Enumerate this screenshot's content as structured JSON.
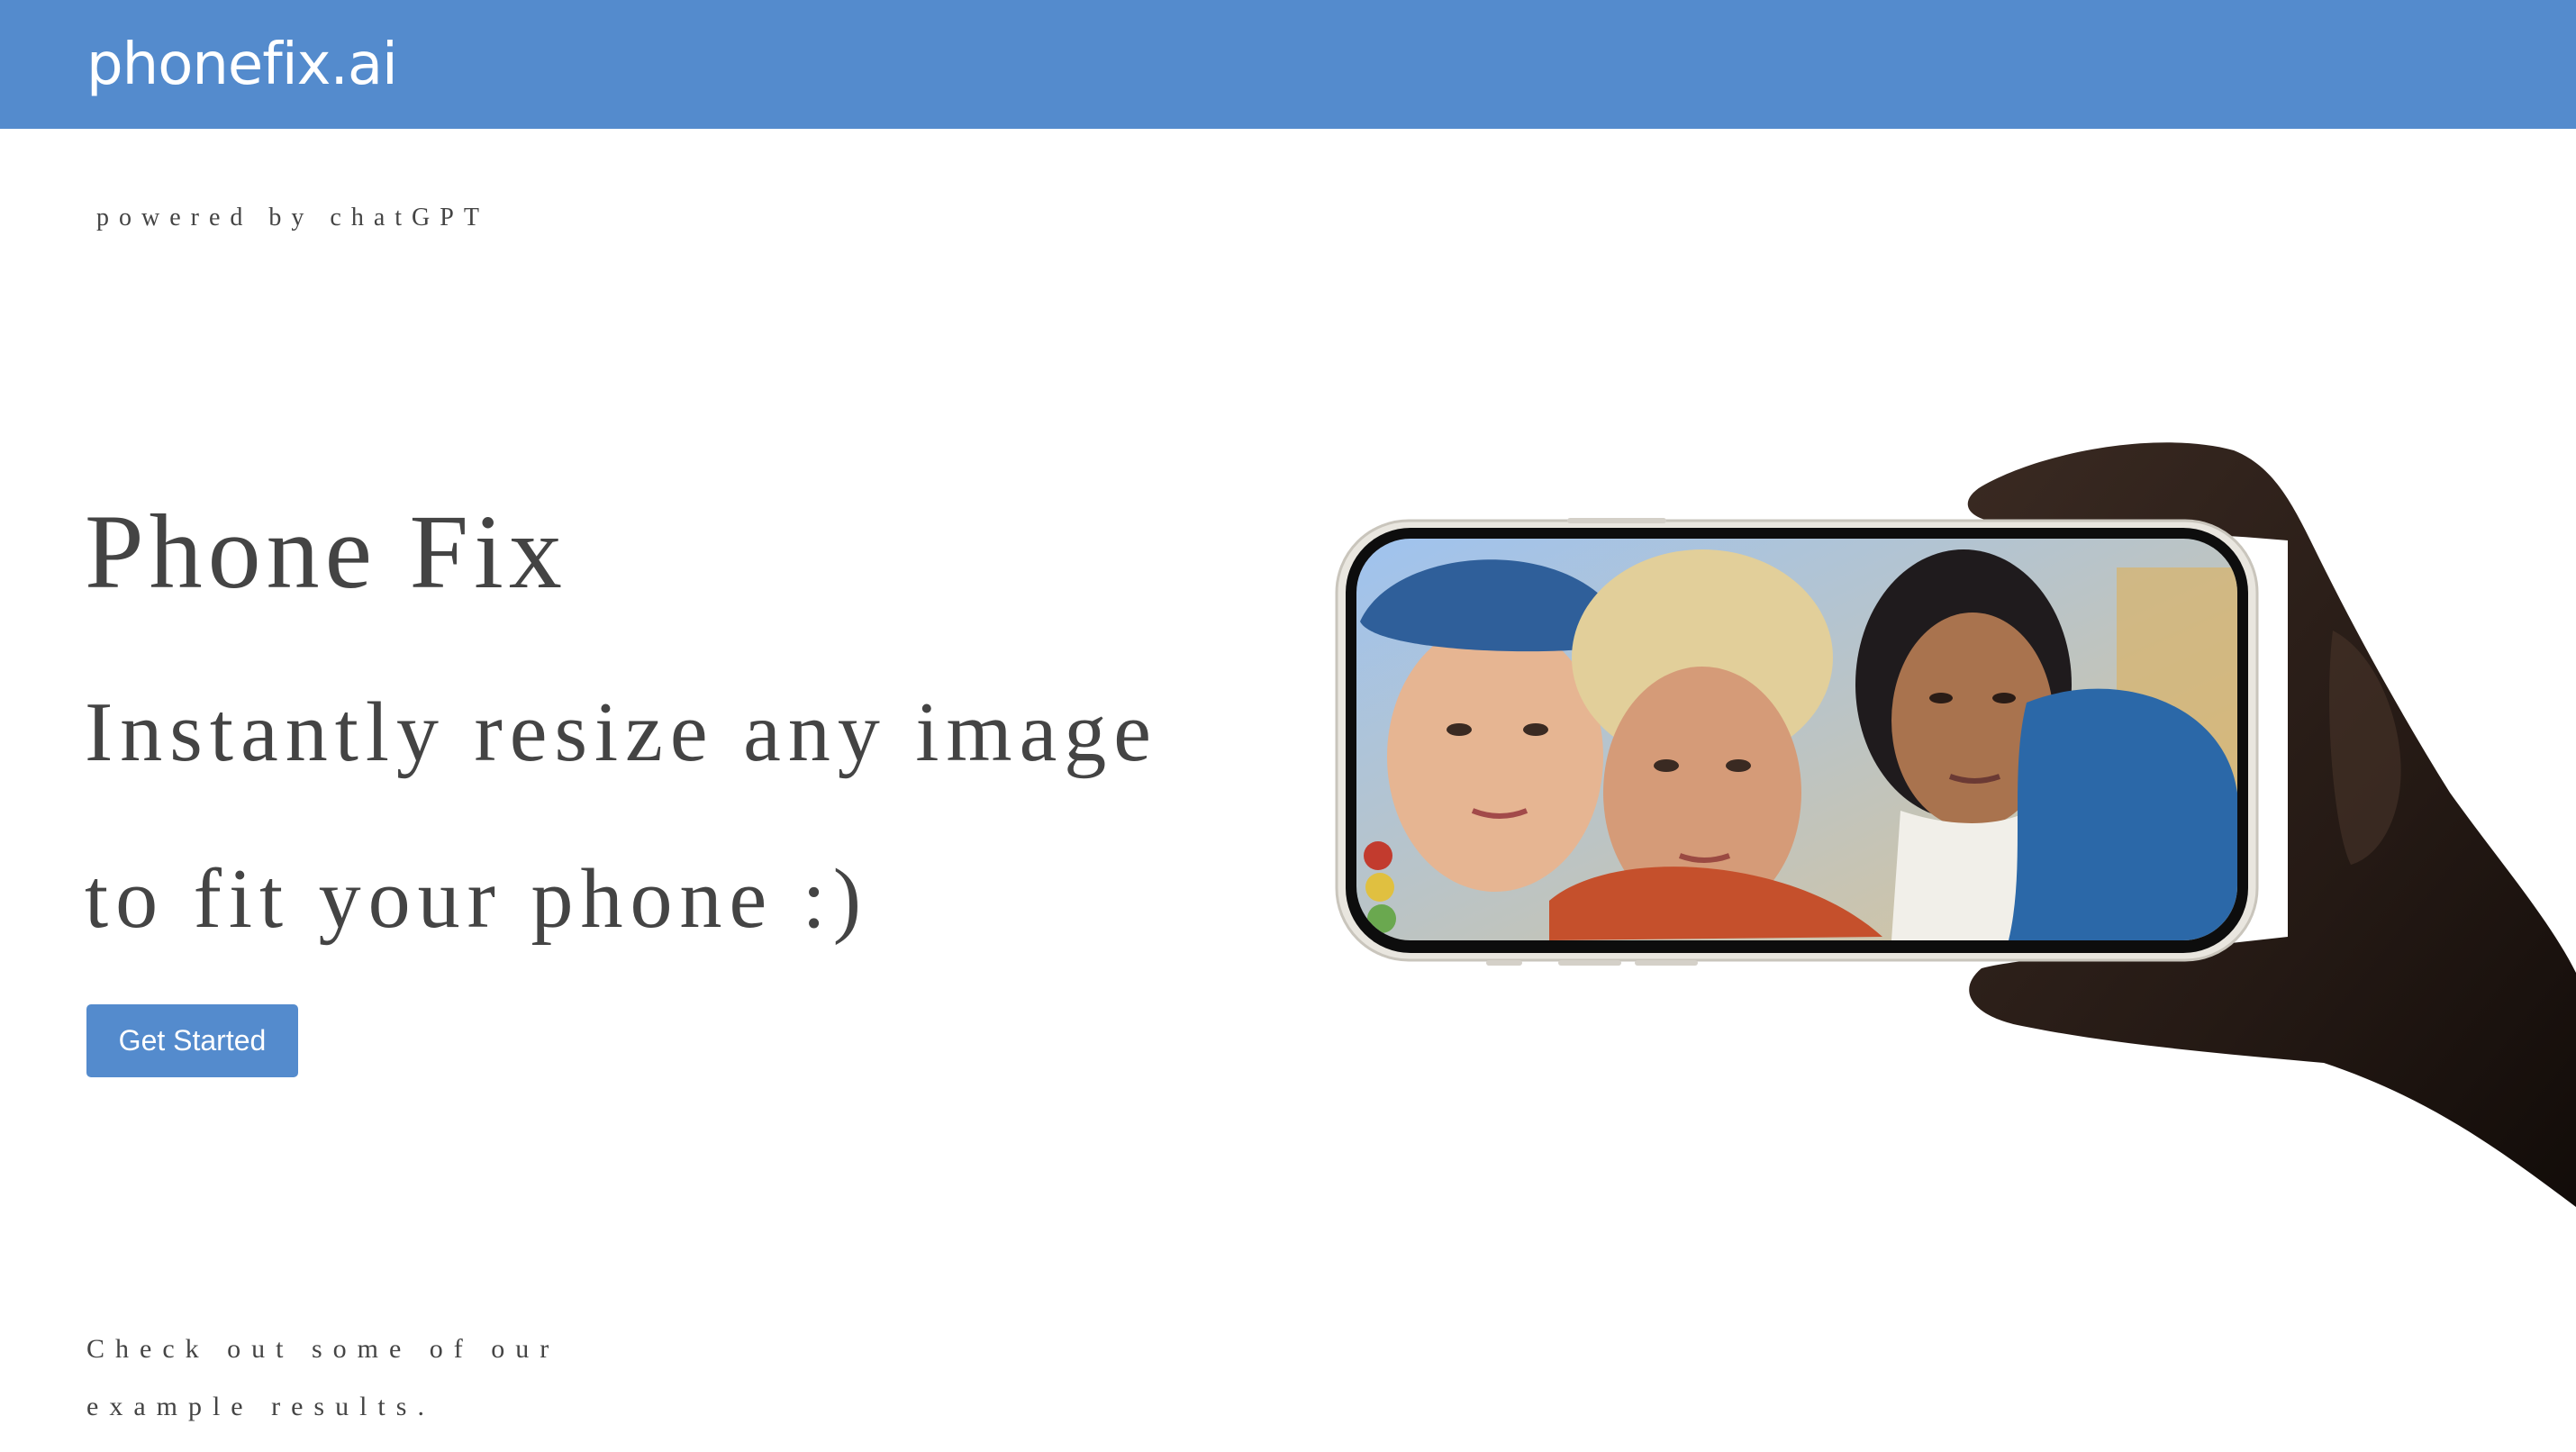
{
  "header": {
    "brand": "phonefix.ai"
  },
  "tagline": "powered by chatGPT",
  "hero": {
    "title": "Phone Fix",
    "line1": "Instantly resize any image",
    "line2": "to fit your phone :)",
    "cta_label": "Get Started"
  },
  "examples": {
    "text": "Check out some of our example results."
  },
  "colors": {
    "brand_blue": "#548bcd",
    "text_gray": "#444444",
    "background": "#ffffff"
  },
  "illustration": {
    "icon": "hand-holding-phone-selfie"
  }
}
